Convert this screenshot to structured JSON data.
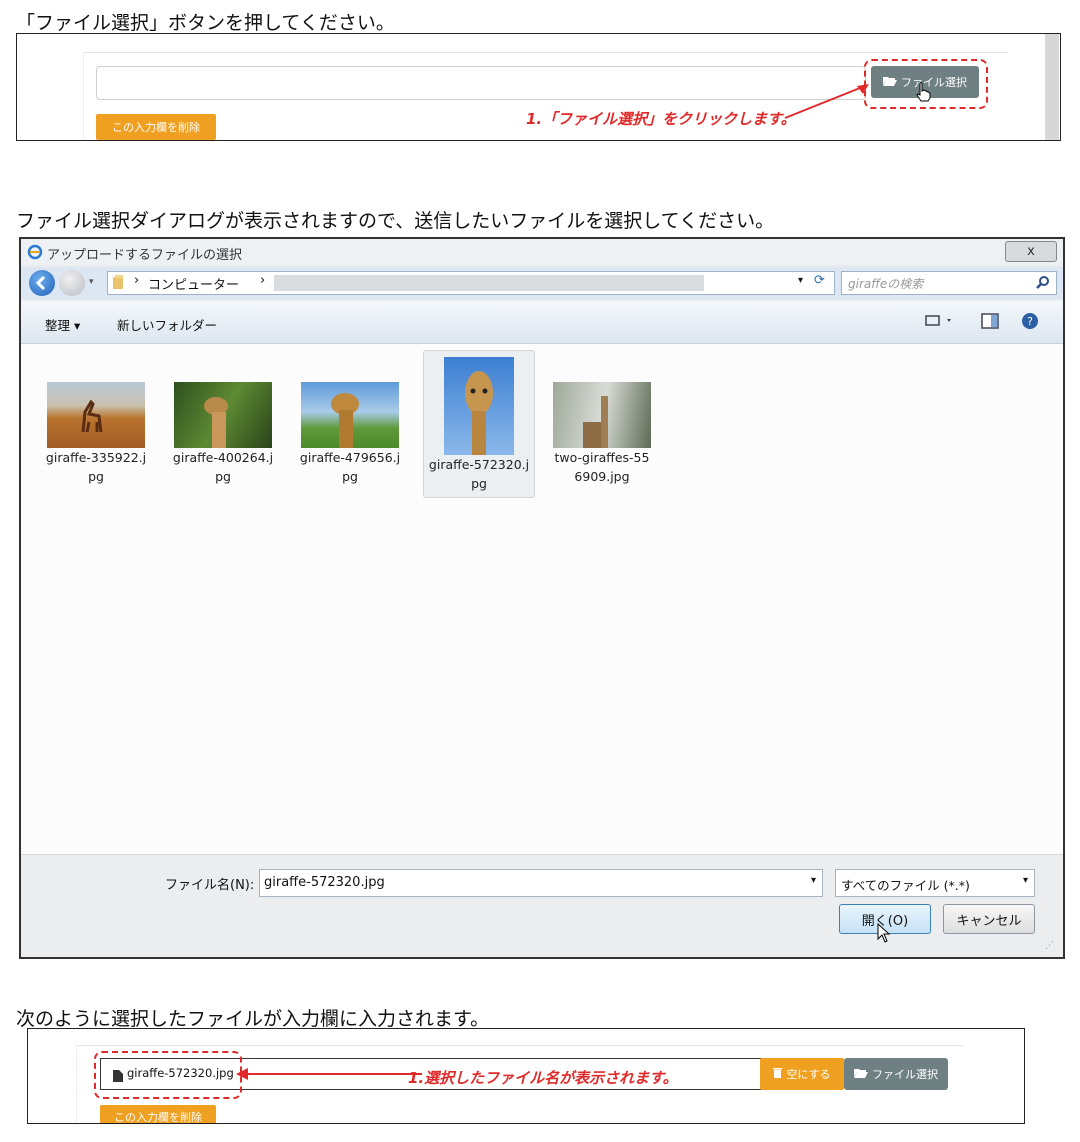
{
  "step1": {
    "instruction": "「ファイル選択」ボタンを押してください。",
    "file_select_label": "ファイル選択",
    "delete_field_label": "この入力欄を削除",
    "annotation": "1.「ファイル選択」をクリックします。"
  },
  "step2": {
    "instruction": "ファイル選択ダイアログが表示されますので、送信したいファイルを選択してください。",
    "dialog": {
      "title": "アップロードするファイルの選択",
      "close": "x",
      "breadcrumb": "コンピューター",
      "search_placeholder": "giraffeの検索",
      "organize": "整理 ▾",
      "new_folder": "新しいフォルダー",
      "files": [
        {
          "name": "giraffe-335922.jpg",
          "label_line1": "giraffe-335922.j",
          "label_line2": "pg"
        },
        {
          "name": "giraffe-400264.jpg",
          "label_line1": "giraffe-400264.j",
          "label_line2": "pg"
        },
        {
          "name": "giraffe-479656.jpg",
          "label_line1": "giraffe-479656.j",
          "label_line2": "pg"
        },
        {
          "name": "giraffe-572320.jpg",
          "label_line1": "giraffe-572320.j",
          "label_line2": "pg",
          "selected": true
        },
        {
          "name": "two-giraffes-556909.jpg",
          "label_line1": "two-giraffes-55",
          "label_line2": "6909.jpg"
        }
      ],
      "filename_label": "ファイル名(N):",
      "filename_value": "giraffe-572320.jpg",
      "filetype_value": "すべてのファイル (*.*)",
      "open": "開く(O)",
      "cancel": "キャンセル"
    }
  },
  "step3": {
    "instruction": "次のように選択したファイルが入力欄に入力されます。",
    "filename": "giraffe-572320.jpg",
    "annotation": "1.選択したファイル名が表示されます。",
    "clear_label": "空にする",
    "file_select_label": "ファイル選択",
    "delete_field_label": "この入力欄を削除"
  },
  "colors": {
    "annotation_red": "#e02a2a",
    "button_grey": "#6f8083",
    "button_orange": "#f0a020"
  }
}
